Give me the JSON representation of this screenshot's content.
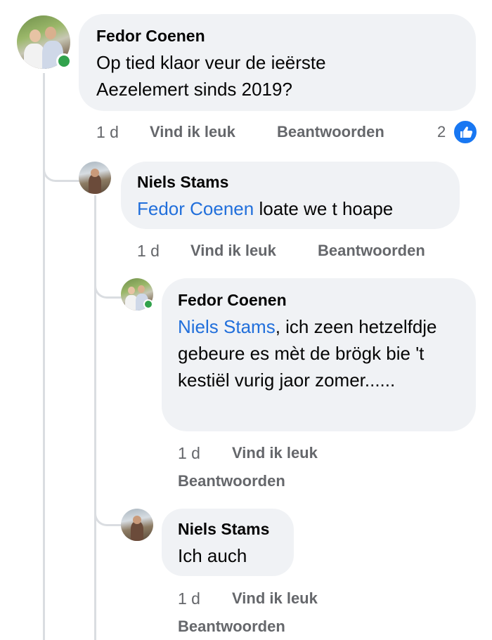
{
  "comments": [
    {
      "author": "Fedor Coenen",
      "text": "Op tied klaor veur de ieërste Aezelemert sinds 2019?",
      "time": "1 d",
      "like_label": "Vind ik leuk",
      "reply_label": "Beantwoorden",
      "reaction_count": "2",
      "reaction_icon": "like-icon",
      "online": true
    },
    {
      "author": "Niels Stams",
      "mention": "Fedor Coenen",
      "text": " loate we t hoape",
      "time": "1 d",
      "like_label": "Vind ik leuk",
      "reply_label": "Beantwoorden"
    },
    {
      "author": "Fedor Coenen",
      "mention": "Niels Stams",
      "text": ", ich zeen hetzelfdje gebeure es mèt de brögk bie 't kestiël vurig jaor zomer......",
      "time": "1 d",
      "like_label": "Vind ik leuk",
      "reply_label": "Beantwoorden",
      "online": true
    },
    {
      "author": "Niels Stams",
      "text": "Ich auch",
      "time": "1 d",
      "like_label": "Vind ik leuk",
      "reply_label": "Beantwoorden"
    }
  ],
  "colors": {
    "bubble": "#f0f2f5",
    "mention": "#216fdb",
    "meta": "#65676b",
    "online": "#31a24c",
    "like": "#1877f2"
  }
}
